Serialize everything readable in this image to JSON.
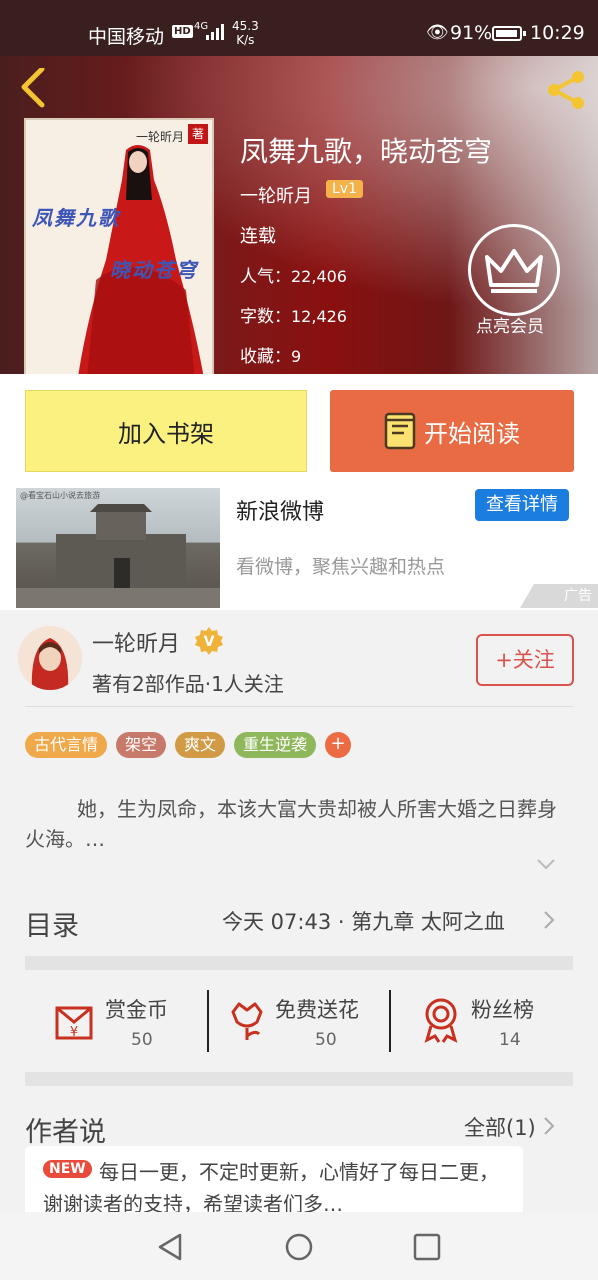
{
  "status_bar": {
    "carrier": "中国移动",
    "hd": "HD",
    "network": "4G",
    "speed_value": "45.3",
    "speed_unit": "K/s",
    "battery": "91%",
    "time": "10:29"
  },
  "book": {
    "title": "凤舞九歌，晓动苍穹",
    "author": "一轮昕月",
    "level": "Lv1",
    "status": "连载",
    "popularity_label": "人气：",
    "popularity": "22,406",
    "words_label": "字数：",
    "words": "12,426",
    "favorites_label": "收藏：",
    "favorites": "9",
    "cover_title_1": "凤舞九歌",
    "cover_title_2": "晓动苍穹",
    "cover_author": "一轮昕月",
    "cover_seal": "著"
  },
  "vip": {
    "label": "点亮会员"
  },
  "actions": {
    "add_shelf": "加入书架",
    "start_reading": "开始阅读"
  },
  "ad": {
    "title": "新浪微博",
    "button": "查看详情",
    "description": "看微博，聚焦兴趣和热点",
    "tag": "广告",
    "image_credit": "@看宝石山小说去旅游"
  },
  "author_info": {
    "name": "一轮昕月",
    "meta": "著有2部作品·1人关注",
    "follow": "+关注"
  },
  "tags": [
    {
      "label": "古代言情",
      "color": "#f0a94a"
    },
    {
      "label": "架空",
      "color": "#c87a6a"
    },
    {
      "label": "爽文",
      "color": "#d19a45"
    },
    {
      "label": "重生逆袭",
      "color": "#8fb85c"
    }
  ],
  "tag_more": "+",
  "description": "她，生为凤命，本该大富大贵却被人所害大婚之日葬身火海。…",
  "catalog": {
    "label": "目录",
    "latest": "今天 07:43 · 第九章 太阿之血"
  },
  "rewards": [
    {
      "label": "赏金币",
      "value": "50",
      "icon": "red-envelope-icon"
    },
    {
      "label": "免费送花",
      "value": "50",
      "icon": "flower-icon"
    },
    {
      "label": "粉丝榜",
      "value": "14",
      "icon": "medal-icon"
    }
  ],
  "author_says": {
    "label": "作者说",
    "all": "全部(1)",
    "new_badge": "NEW",
    "text": "每日一更，不定时更新，心情好了每日二更，谢谢读者的支持，希望读者们多…"
  },
  "colors": {
    "accent": "#e96b44",
    "shelf_button": "#fbf181",
    "follow": "#d9534f",
    "ad_button": "#1c7de0"
  }
}
